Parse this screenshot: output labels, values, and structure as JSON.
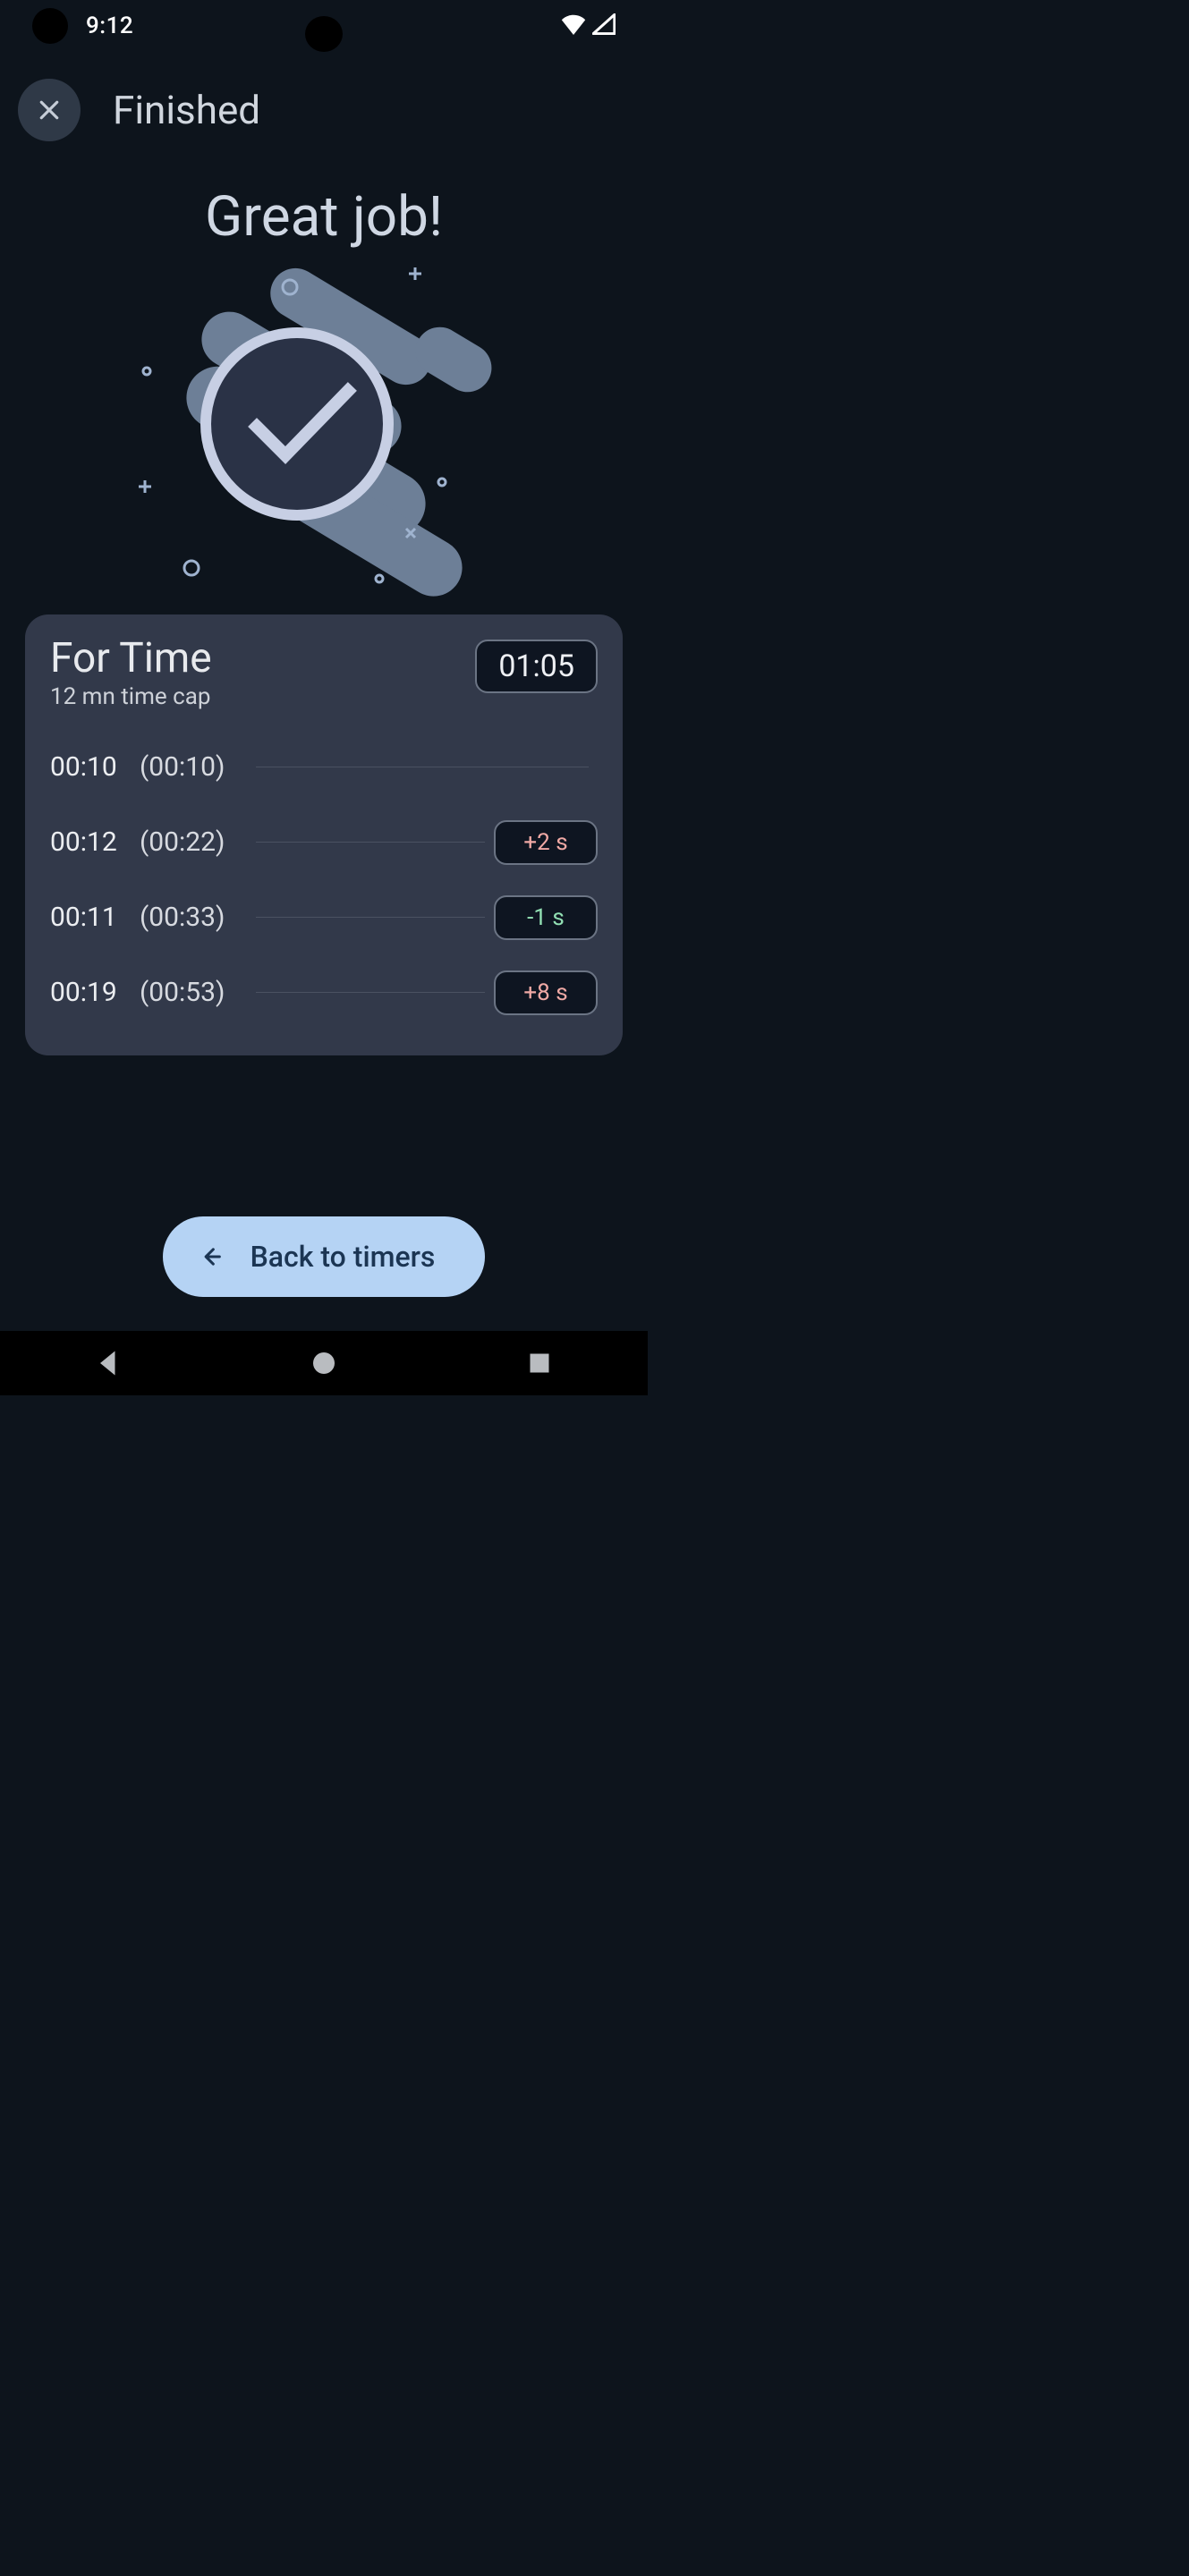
{
  "status": {
    "time": "9:12"
  },
  "header": {
    "title": "Finished"
  },
  "hero": {
    "text": "Great job!"
  },
  "card": {
    "title": "For Time",
    "subtitle": "12 mn time cap",
    "total": "01:05",
    "splits": [
      {
        "lap": "00:10",
        "cum": "(00:10)",
        "delta": "",
        "delta_sign": ""
      },
      {
        "lap": "00:12",
        "cum": "(00:22)",
        "delta": "+2 s",
        "delta_sign": "pos"
      },
      {
        "lap": "00:11",
        "cum": "(00:33)",
        "delta": "-1 s",
        "delta_sign": "neg"
      },
      {
        "lap": "00:19",
        "cum": "(00:53)",
        "delta": "+8 s",
        "delta_sign": "pos"
      }
    ]
  },
  "footer": {
    "back_label": "Back to timers"
  }
}
